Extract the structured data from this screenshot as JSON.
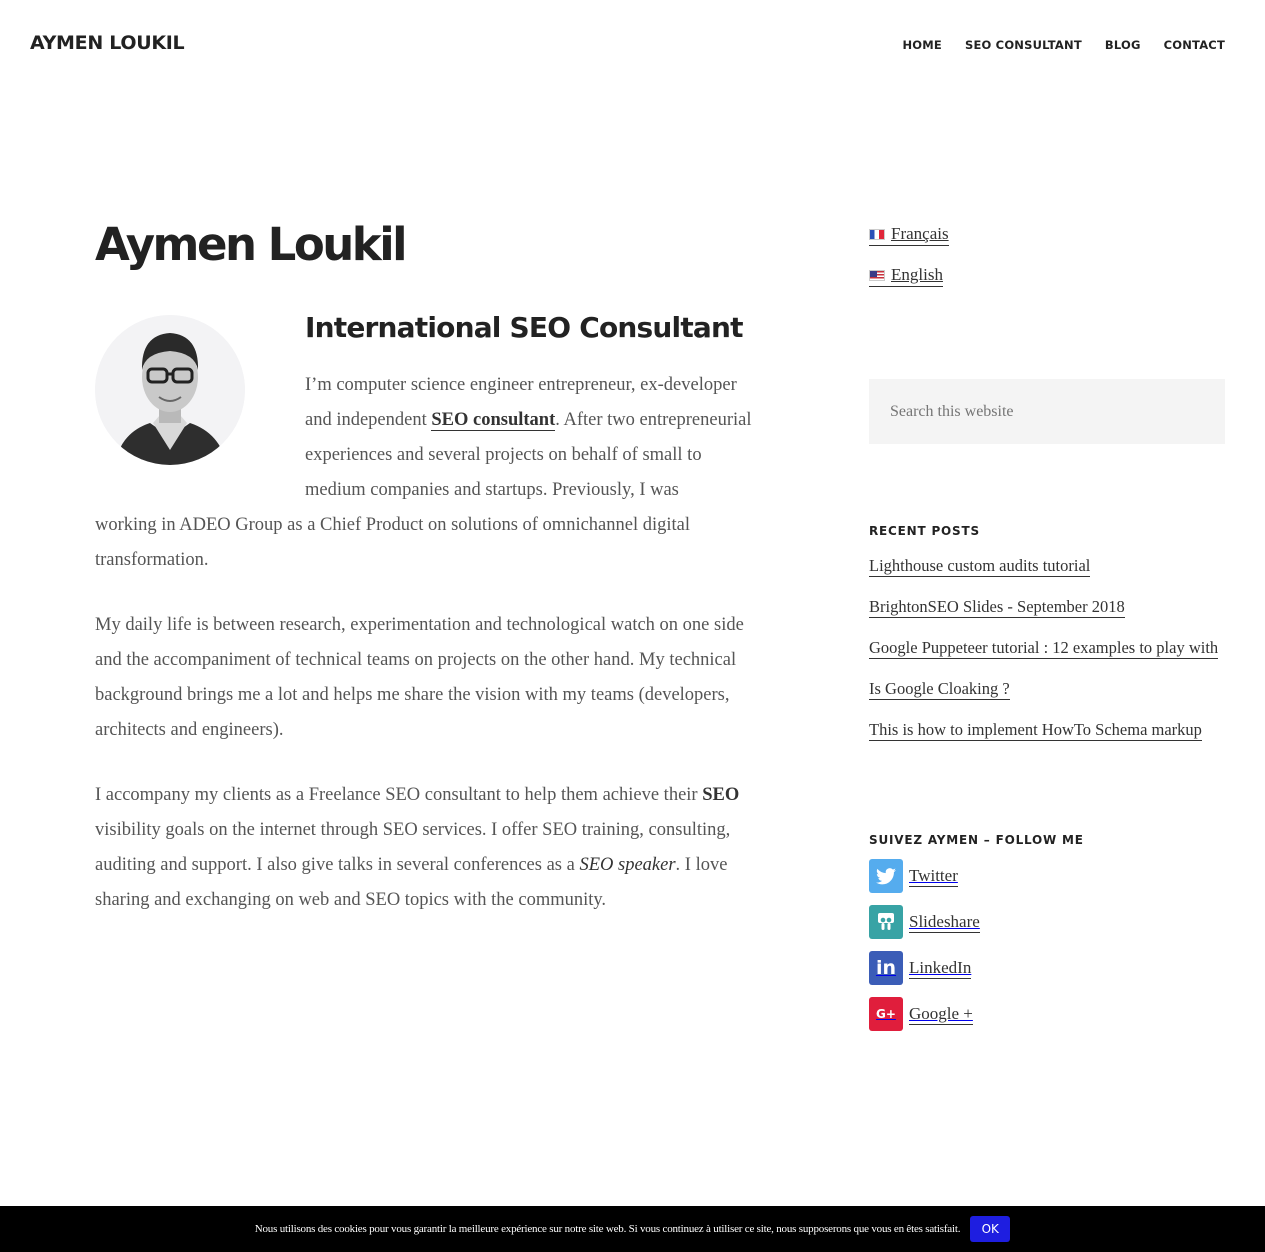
{
  "header": {
    "site_title": "AYMEN LOUKIL",
    "nav": [
      "HOME",
      "SEO CONSULTANT",
      "BLOG",
      "CONTACT"
    ]
  },
  "main": {
    "title": "Aymen Loukil",
    "subtitle": "International SEO Consultant",
    "p1": {
      "before_link": "I’m computer science engineer entrepreneur, ex-developer and independent ",
      "link": "SEO consultant",
      "after_link": ". After two entrepreneurial experiences and several projects on behalf of small to medium companies and startups. Previously, I was",
      "continuation": "working in ADEO Group as a Chief Product on solutions of omnichannel digital transformation."
    },
    "p2": "My daily life is between research, experimentation and technological watch on one side and the accompaniment of technical teams on projects on the other hand. My technical background brings me a lot and helps me share the vision with my teams (developers, architects and engineers).",
    "p3": {
      "part1": "I accompany my clients as a Freelance SEO consultant to help them achieve their ",
      "bold": "SEO",
      "part2": " visibility goals on the internet through SEO services. I offer SEO training, consulting, auditing and support. I also give talks in several conferences as a ",
      "italic": "SEO speaker",
      "part3": ". I love sharing and exchanging on web and SEO topics with the community."
    }
  },
  "sidebar": {
    "languages": [
      {
        "label": "Français",
        "flag": "flag-fr"
      },
      {
        "label": "English",
        "flag": "flag-us"
      }
    ],
    "search_placeholder": "Search this website",
    "recent_posts_title": "RECENT POSTS",
    "recent_posts": [
      "Lighthouse custom audits tutorial",
      "BrightonSEO Slides - September 2018",
      "Google Puppeteer tutorial : 12 examples to play with",
      "Is Google Cloaking ?",
      "This is how to implement HowTo Schema markup"
    ],
    "follow_title": "SUIVEZ AYMEN – FOLLOW ME",
    "social": [
      {
        "label": "Twitter",
        "icon": "twitter-icon",
        "color": "#55acee"
      },
      {
        "label": "Slideshare",
        "icon": "slideshare-icon",
        "color": "#38a3a5"
      },
      {
        "label": "LinkedIn",
        "icon": "linkedin-icon",
        "color": "#3b5db7"
      },
      {
        "label": "Google +",
        "icon": "google-plus-icon",
        "color": "#e01e3c"
      }
    ]
  },
  "cookie": {
    "text": "Nous utilisons des cookies pour vous garantir la meilleure expérience sur notre site web. Si vous continuez à utiliser ce site, nous supposerons que vous en êtes satisfait.",
    "button": "OK",
    "button_color": "#1e1ee0"
  }
}
